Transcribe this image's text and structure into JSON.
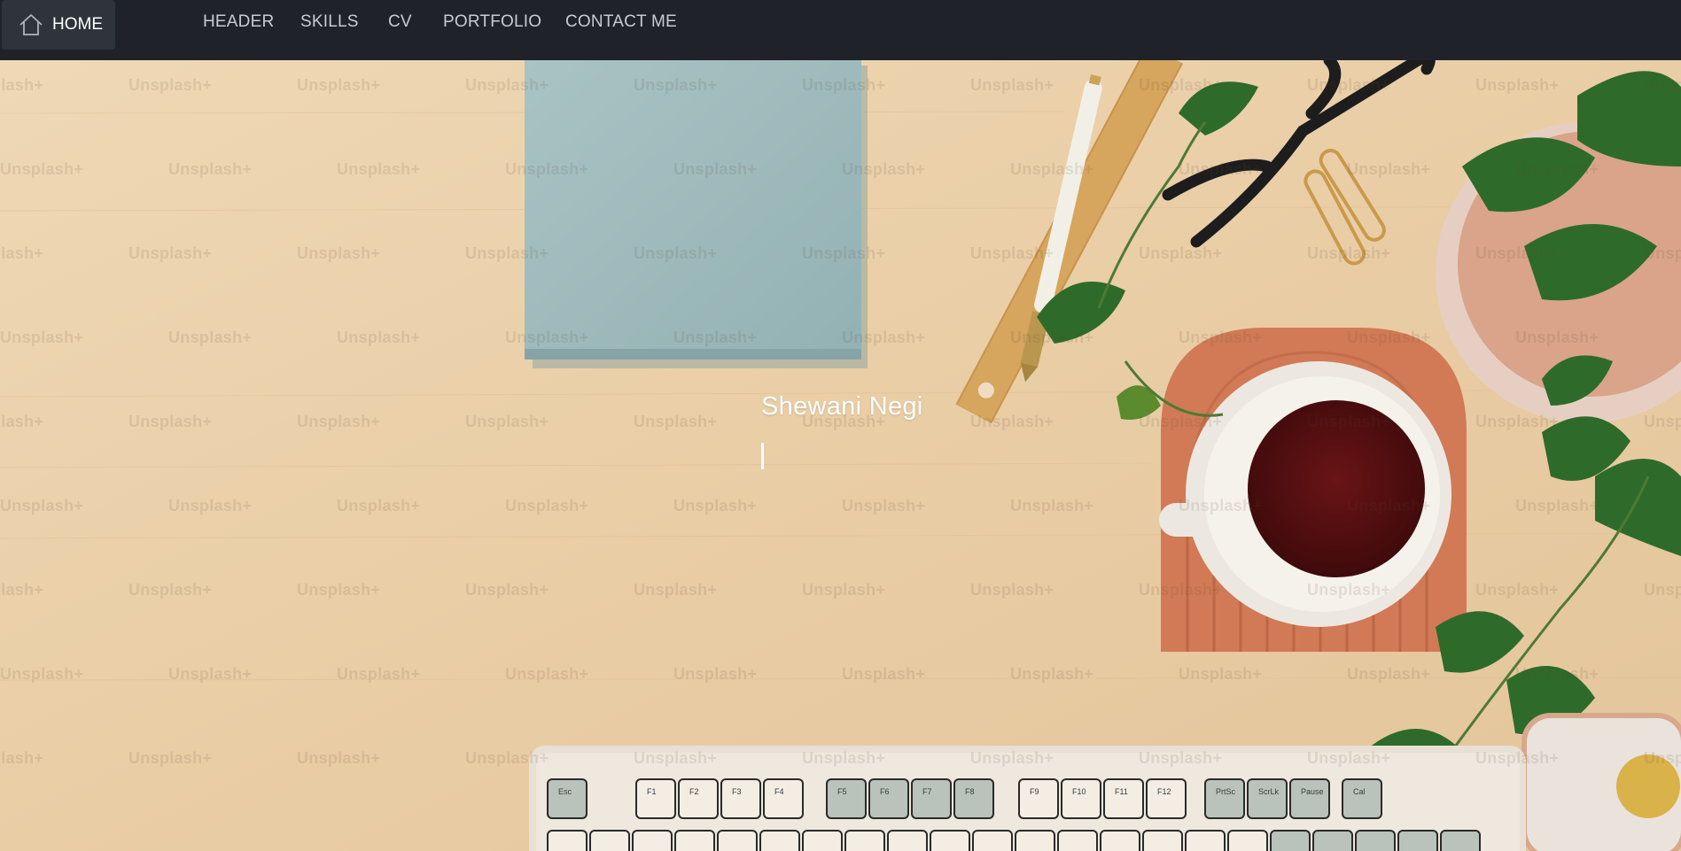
{
  "nav": {
    "home": {
      "label": "HOME",
      "icon": "home-icon"
    },
    "links": [
      {
        "label": "HEADER"
      },
      {
        "label": "SKILLS"
      },
      {
        "label": "CV"
      },
      {
        "label": "PORTFOLIO"
      },
      {
        "label": "CONTACT ME"
      }
    ]
  },
  "hero": {
    "name": "Shewani Negi",
    "watermark": "Unsplash+"
  },
  "keyboard": {
    "keys_row1": [
      "Esc",
      "F1",
      "F2",
      "F3",
      "F4",
      "F5",
      "F6",
      "F7",
      "F8",
      "F9",
      "F10",
      "F11",
      "F12",
      "PrtSc",
      "ScrLk",
      "Pause",
      "Cal"
    ]
  },
  "colors": {
    "navbar_bg": "#1f2329",
    "home_bg": "#2f343b",
    "desk": "#eacfa8",
    "box": "#9fbcbf",
    "coaster": "#d97e5a",
    "tea": "#5a1012"
  }
}
